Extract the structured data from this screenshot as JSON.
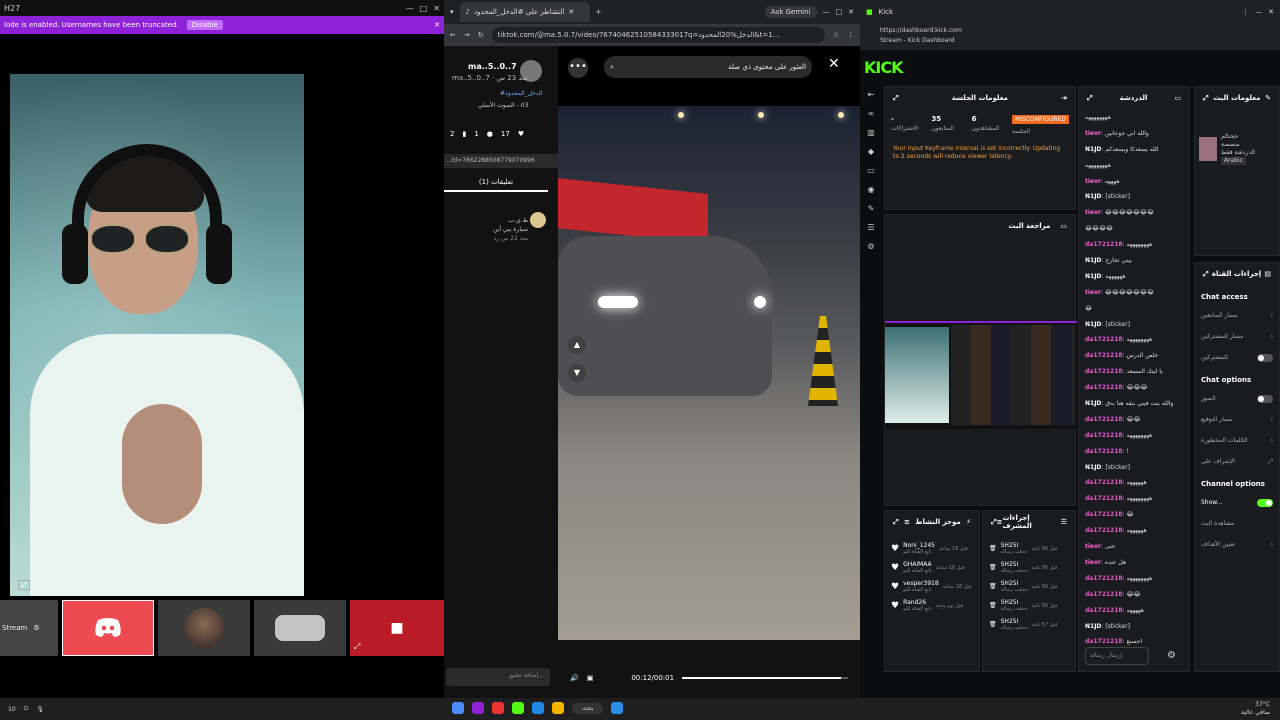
{
  "left": {
    "topbar": {
      "title": "H27"
    },
    "notice": {
      "text": "lode is enabled. Usernames have been truncated.",
      "disable": "Disable"
    },
    "tiles": {
      "stream_label": "Stream"
    }
  },
  "tiktok": {
    "tab_title": "التشاطر على #الدخل_المحدود",
    "gemini": "Ask Gemini",
    "url": "tiktok.com/@ma.5.0.7/video/76740462510584333017q=الدخل%20المحدود&t=1...",
    "profile": {
      "name": "ma..5..0..7",
      "handle": "ma..5..0..7 · منذ 23 س",
      "hashtag": "#الدخل_المحدود",
      "sound": "الصوت الأصلي - ri3",
      "likes": "17",
      "comments": "1",
      "saves": "2",
      "video_id": "...ld=7662288508779070996"
    },
    "comments_tab": "تعليقات (1)",
    "comment": {
      "user": "ط.ي.ب",
      "text": "سيارة بيي أين",
      "time": "منذ 22 س  رد"
    },
    "add_comment": "إضافة تعليق...",
    "search_text": "العثور على محتوى ذي صلة",
    "time": "00:12/00:01",
    "progress_percent": 96
  },
  "kick": {
    "tab_title": "Kick",
    "url": "https://dashboard.kick.com",
    "url_sub": "Stream - Kick Dashboard",
    "logo": "KICK",
    "session": {
      "title": "معلومات الجلسة",
      "badge": "MISCONFIGURED",
      "stats": [
        {
          "value": "6",
          "label": "المشاهدون"
        },
        {
          "value": "35",
          "label": "المتابعون"
        },
        {
          "value": "-",
          "label": "الاشتراكات"
        }
      ],
      "session_label": "الجلسة",
      "warning": "Your input Keyframe interval is set incorrectly. Updating to 2 seconds will reduce viewer latency."
    },
    "preview_title": "مراجعة البث",
    "feed": {
      "title": "موجز النشاط",
      "items": [
        {
          "name": "Noni_1245",
          "sub": "تابع القناة للتو",
          "time": "قبل 18 ساعة"
        },
        {
          "name": "GHAIMAA",
          "sub": "تابع القناة للتو",
          "time": "قبل 18 ساعة"
        },
        {
          "name": "vesper3918",
          "sub": "تابع القناة للتو",
          "time": "قبل 18 ساعة"
        },
        {
          "name": "Rand26",
          "sub": "تابع القناة للتو",
          "time": "قبل يوم واحد"
        }
      ]
    },
    "mod": {
      "title": "إجراءات المشرف",
      "items": [
        {
          "name": "SH25I",
          "sub": "حذفت رسالة",
          "time": "قبل 56 ثانية"
        },
        {
          "name": "SH25I",
          "sub": "حذفت رسالة",
          "time": "قبل 56 ثانية"
        },
        {
          "name": "SH25I",
          "sub": "حذفت رسالة",
          "time": "قبل 56 ثانية"
        },
        {
          "name": "SH25I",
          "sub": "حذفت رسالة",
          "time": "قبل 56 ثانية"
        },
        {
          "name": "SH25I",
          "sub": "حذفت رسالة",
          "time": "قبل 57 ثانية"
        }
      ]
    },
    "chat": {
      "title": "الدردشة",
      "input": "إرسال رسالة",
      "lines": [
        {
          "user": "",
          "text": "ههههههههه",
          "color": "#ffffff"
        },
        {
          "user": "tievr",
          "text": "والله اني جوعانين",
          "color": "#ff6bd6"
        },
        {
          "user": "N1JD",
          "text": "الله يسعدكا ويسعدكم",
          "color": "#ffffff"
        },
        {
          "user": "",
          "text": "ههههههههه",
          "color": "#ffffff"
        },
        {
          "user": "tievr",
          "text": "ههههه",
          "color": "#ff6bd6"
        },
        {
          "user": "N1JD",
          "text": "[sticker]",
          "color": "#ffffff"
        },
        {
          "user": "tievr",
          "text": "😂😂😂😂😂😂😂",
          "color": "#ff6bd6"
        },
        {
          "user": "",
          "text": "😂😂😂😂",
          "color": "#ffffff"
        },
        {
          "user": "da1721218",
          "text": "ههههههههه",
          "color": "#e45bc6"
        },
        {
          "user": "N1JD",
          "text": "يبني تخارج",
          "color": "#ffffff"
        },
        {
          "user": "N1JD",
          "text": "ههههههه",
          "color": "#ffffff"
        },
        {
          "user": "tievr",
          "text": "😂😂😂😂😂😂😂",
          "color": "#ff6bd6"
        },
        {
          "user": "",
          "text": "😂",
          "color": "#ffffff"
        },
        {
          "user": "N1JD",
          "text": "[sticker]",
          "color": "#ffffff"
        },
        {
          "user": "da1721218",
          "text": "ههههههههه",
          "color": "#e45bc6"
        },
        {
          "user": "da1721218",
          "text": "خلص الدرس",
          "color": "#e45bc6"
        },
        {
          "user": "da1721218",
          "text": "يا ليتك المسعد",
          "color": "#e45bc6"
        },
        {
          "user": "da1721218",
          "text": "😂😂😂",
          "color": "#e45bc6"
        },
        {
          "user": "N1JD",
          "text": "والله بنت فيني بنقه هنا بدق",
          "color": "#ffffff"
        },
        {
          "user": "da1721218",
          "text": "😂😂",
          "color": "#e45bc6"
        },
        {
          "user": "da1721218",
          "text": "ههههههههه",
          "color": "#e45bc6"
        },
        {
          "user": "da1721218",
          "text": "!",
          "color": "#e45bc6"
        },
        {
          "user": "N1JD",
          "text": "[sticker]",
          "color": "#ffffff"
        },
        {
          "user": "da1721218",
          "text": "ههههههه",
          "color": "#e45bc6"
        },
        {
          "user": "da1721218",
          "text": "ههههههههه",
          "color": "#e45bc6"
        },
        {
          "user": "da1721218",
          "text": "😂",
          "color": "#e45bc6"
        },
        {
          "user": "da1721218",
          "text": "ههههههه",
          "color": "#e45bc6"
        },
        {
          "user": "tievr",
          "text": "حتى",
          "color": "#ff6bd6"
        },
        {
          "user": "tievr",
          "text": "هل عنده",
          "color": "#ff6bd6"
        },
        {
          "user": "da1721218",
          "text": "ههههههههه",
          "color": "#e45bc6"
        },
        {
          "user": "da1721218",
          "text": "😂😂",
          "color": "#e45bc6"
        },
        {
          "user": "da1721218",
          "text": "هههههه",
          "color": "#e45bc6"
        },
        {
          "user": "N1JD",
          "text": "[sticker]",
          "color": "#ffffff"
        },
        {
          "user": "da1721218",
          "text": "احسنع",
          "color": "#e45bc6"
        }
      ]
    },
    "meta": {
      "title": "معلومات البث",
      "line1": "حجنالم",
      "line2": "منصصة",
      "line3": "الدردشة فقط",
      "lang": "Arabic"
    },
    "actions": {
      "title": "إجراءات القناة",
      "chat_access": "Chat access",
      "chat_options": "Chat options",
      "channel_options": "Channel options",
      "rows_access": [
        "مسار المتابعين",
        "مسار للمشتركين",
        "للمشتركين"
      ],
      "rows_options": [
        "الصور",
        "مسار التوقيع",
        "الكلمات المحظورة",
        "الإشراف على"
      ],
      "show_label": "Show...",
      "rows_channel": [
        "مشاهدة البث",
        "تعيين الأهداف"
      ]
    }
  },
  "taskbar": {
    "left_text": "10",
    "search": "بحث",
    "temp": "37°C",
    "weather": "صافي عالية"
  }
}
